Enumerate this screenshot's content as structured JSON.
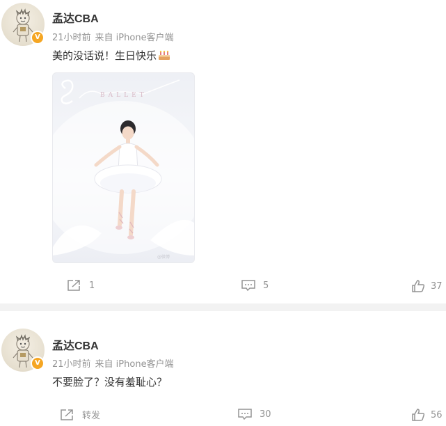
{
  "posts": [
    {
      "username": "孟达CBA",
      "time": "21小时前",
      "source": "来自 iPhone客户端",
      "text": "美的没话说！生日快乐",
      "emoji_icon": "cake-icon",
      "image": {
        "caption_watermark": "SHAREEI BALLET"
      },
      "actions": {
        "repost": "1",
        "comment": "5",
        "like": "37"
      }
    },
    {
      "username": "孟达CBA",
      "time": "21小时前",
      "source": "来自 iPhone客户端",
      "text": "不要脸了？没有羞耻心？",
      "actions": {
        "repost": "转发",
        "comment": "30",
        "like": "56"
      }
    }
  ],
  "colors": {
    "meta": "#939393",
    "text": "#333333",
    "badge": "#f5a623",
    "divider": "#f2f2f2"
  }
}
